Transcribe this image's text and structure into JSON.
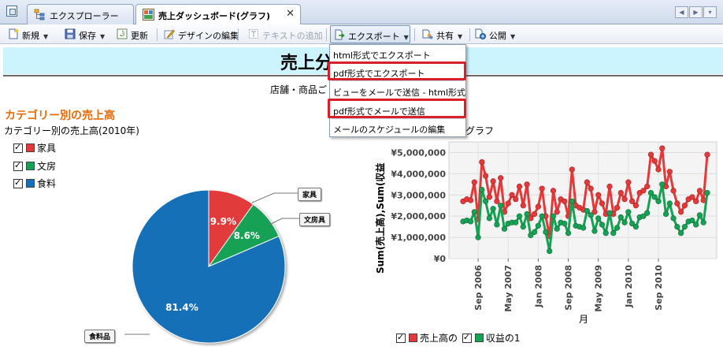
{
  "tabs": [
    {
      "label": "エクスプローラー",
      "active": false
    },
    {
      "label": "売上ダッシュボード(グラフ)",
      "active": true
    }
  ],
  "toolbar": {
    "new": "新規",
    "save": "保存",
    "refresh": "更新",
    "edit_design": "デザインの編集",
    "add_text": "テキストの追加",
    "export": "エクスポート",
    "share": "共有",
    "publish": "公開"
  },
  "export_menu": {
    "items": [
      "html形式でエクスポート",
      "pdf形式でエクスポート",
      "ビューをメールで送信 - html形式",
      "pdf形式でメールで送信",
      "メールのスケジュールの編集"
    ],
    "highlighted": [
      1,
      3
    ],
    "highlight_color": "#d9202a"
  },
  "report": {
    "banner_title": "売上分",
    "subtitle": "店舗・商品ご",
    "banner_color": "#ccf4ff",
    "section_title": "カテゴリー別の売上高",
    "pie_caption": "カテゴリー別の売上高(2010年)",
    "line_caption": "グラフ"
  },
  "pie_legend": [
    {
      "label": "家具",
      "color": "#e23a3a"
    },
    {
      "label": "文房",
      "color": "#17a154"
    },
    {
      "label": "食料",
      "color": "#1470b8"
    }
  ],
  "line_legend": [
    {
      "label": "売上高の",
      "color": "#e23a3a"
    },
    {
      "label": "収益の1",
      "color": "#17a154"
    }
  ],
  "chart_data": [
    {
      "type": "pie",
      "categories": [
        "家具",
        "文房具",
        "食料品"
      ],
      "values": [
        9.9,
        8.6,
        81.4
      ],
      "labels": [
        "9.9%",
        "8.6%",
        "81.4%"
      ],
      "colors": [
        "#e23a3a",
        "#17a154",
        "#1470b8"
      ]
    },
    {
      "type": "line",
      "ylabel": "Sum(売上高),Sum(収益",
      "xlabel": "月",
      "x_ticks": [
        "Sep 2006",
        "May 2007",
        "Jan 2008",
        "Sep 2008",
        "May 2009",
        "Jan 2010",
        "Sep 2010"
      ],
      "y_ticks": [
        "¥0",
        "¥1,000,000",
        "¥2,000,000",
        "¥3,000,000",
        "¥4,000,000",
        "¥5,000,000"
      ],
      "ylim": [
        0,
        5500000
      ],
      "grid": true,
      "series": [
        {
          "name": "売上高の",
          "color": "#e23a3a",
          "values": [
            2700000,
            2800000,
            2750000,
            3600000,
            1850000,
            4550000,
            3900000,
            2900000,
            3650000,
            2700000,
            3800000,
            2200000,
            2600000,
            3000000,
            2800000,
            3400000,
            2500000,
            3500000,
            1900000,
            2100000,
            2450000,
            3300000,
            2000000,
            1050000,
            3200000,
            2200000,
            2800000,
            2700000,
            2000000,
            4200000,
            2500000,
            2400000,
            2300000,
            3600000,
            3300000,
            2200000,
            3000000,
            2600000,
            2100000,
            3400000,
            2100000,
            2400000,
            3100000,
            2800000,
            3600000,
            2700000,
            2500000,
            3100000,
            3200000,
            3400000,
            4900000,
            4600000,
            4200000,
            5200000,
            3400000,
            4100000,
            3200000,
            2600000,
            2200000,
            2500000,
            2800000,
            2900000,
            2700000,
            3200000,
            2750000,
            4900000
          ]
        },
        {
          "name": "収益の1",
          "color": "#17a154",
          "values": [
            1750000,
            1800000,
            1750000,
            2200000,
            1000000,
            3250000,
            2700000,
            1900000,
            2350000,
            1600000,
            2500000,
            1400000,
            1650000,
            1700000,
            1700000,
            2000000,
            1500000,
            2100000,
            1100000,
            1250000,
            1550000,
            2000000,
            1250000,
            350000,
            2000000,
            1400000,
            1700000,
            1650000,
            1200000,
            2700000,
            1550000,
            1500000,
            1450000,
            2250000,
            2050000,
            1300000,
            1900000,
            1600000,
            1200000,
            2150000,
            1200000,
            1450000,
            1950000,
            1700000,
            2200000,
            1650000,
            1500000,
            1950000,
            2000000,
            2150000,
            3100000,
            2900000,
            2700000,
            3500000,
            2100000,
            2600000,
            1900000,
            1500000,
            1200000,
            1500000,
            1750000,
            1800000,
            1600000,
            2050000,
            1700000,
            3100000
          ]
        }
      ]
    }
  ]
}
